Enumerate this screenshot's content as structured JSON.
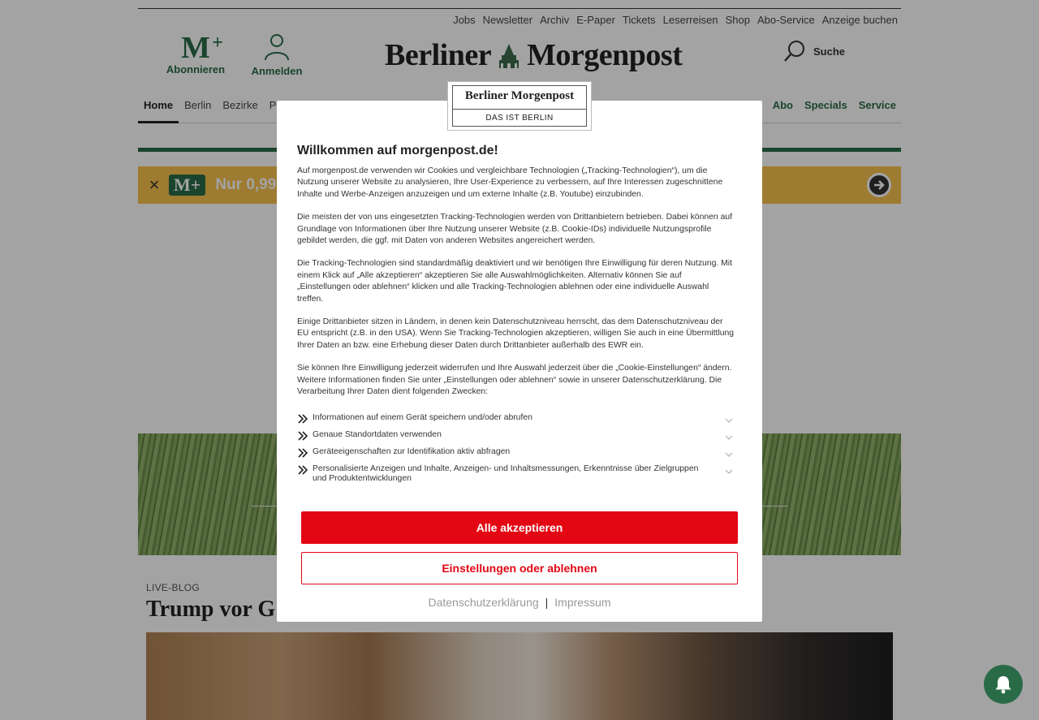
{
  "utility_nav": [
    "Jobs",
    "Newsletter",
    "Archiv",
    "E-Paper",
    "Tickets",
    "Leserreisen",
    "Shop",
    "Abo-Service",
    "Anzeige buchen"
  ],
  "account": {
    "abo_logo": "M",
    "abo_plus": "+",
    "abo_label": "Abonnieren",
    "login_label": "Anmelden",
    "icons": {
      "abo": "m-plus-logo-icon",
      "login": "person-icon"
    }
  },
  "logo": {
    "left": "Berliner",
    "right": "Morgenpost",
    "icon": "brandenburg-gate-crest-icon"
  },
  "search": {
    "label": "Suche",
    "icon": "search-icon"
  },
  "main_nav": {
    "items": [
      {
        "label": "Home",
        "active": true
      },
      {
        "label": "Berlin",
        "active": false
      },
      {
        "label": "Bezirke",
        "active": false
      },
      {
        "label": "Politik",
        "active": false
      }
    ],
    "right_items": [
      "Abo",
      "Specials",
      "Service"
    ]
  },
  "promo": {
    "badge": "M+",
    "text": "Nur 0,99",
    "close_icon": "close-icon",
    "arrow_icon": "arrow-right-circle-icon"
  },
  "article": {
    "kicker": "LIVE-BLOG",
    "headline": "Trump vor G"
  },
  "bell_icon": "notification-bell-icon",
  "consent": {
    "logo_name": "Berliner Morgenpost",
    "logo_sub": "DAS IST BERLIN",
    "title": "Willkommen auf morgenpost.de!",
    "paragraphs": [
      "Auf morgenpost.de verwenden wir Cookies und vergleichbare Technologien („Tracking-Technologien“), um die Nutzung unserer Website zu analysieren, Ihre User-Experience zu verbessern, auf Ihre Interessen zugeschnittene Inhalte und Werbe-Anzeigen anzuzeigen und um externe Inhalte (z.B. Youtube) einzubinden.",
      "Die meisten der von uns eingesetzten Tracking-Technologien werden von Drittanbietern betrieben. Dabei können auf Grundlage von Informationen über Ihre Nutzung unserer Website (z.B. Cookie-IDs) individuelle Nutzungsprofile gebildet werden, die ggf. mit Daten von anderen Websites angereichert werden.",
      "Die Tracking-Technologien sind standardmäßig deaktiviert und wir benötigen Ihre Einwilligung für deren Nutzung. Mit einem Klick auf „Alle akzeptieren“ akzeptieren Sie alle Auswahlmöglichkeiten. Alternativ können Sie auf „Einstellungen oder ablehnen“ klicken und alle Tracking-Technologien ablehnen oder eine individuelle Auswahl treffen.",
      "Einige Drittanbieter sitzen in Ländern, in denen kein Datenschutzniveau herrscht, das dem Datenschutzniveau der EU entspricht (z.B. in den USA). Wenn Sie Tracking-Technologien akzeptieren, willigen Sie auch in eine Übermittlung Ihrer Daten an bzw. eine Erhebung dieser Daten durch Drittanbieter außerhalb des EWR ein.",
      "Sie können Ihre Einwilligung jederzeit widerrufen und Ihre Auswahl jederzeit über die „Cookie-Einstellungen“ ändern. Weitere Informationen finden Sie unter „Einstellungen oder ablehnen“ sowie in unserer Datenschutzerklärung. Die Verarbeitung Ihrer Daten dient folgenden Zwecken:"
    ],
    "purposes": [
      "Informationen auf einem Gerät speichern und/oder abrufen",
      "Genaue Standortdaten verwenden",
      "Geräteeigenschaften zur Identifikation aktiv abfragen",
      "Personalisierte Anzeigen und Inhalte, Anzeigen- und Inhaltsmessungen, Erkenntnisse über Zielgruppen und Produktentwicklungen"
    ],
    "accept_label": "Alle akzeptieren",
    "settings_label": "Einstellungen oder ablehnen",
    "privacy_link": "Datenschutzerklärung",
    "link_separator": "|",
    "imprint_link": "Impressum",
    "colors": {
      "primary": "#e30613",
      "brand_green": "#2a6b47"
    }
  }
}
